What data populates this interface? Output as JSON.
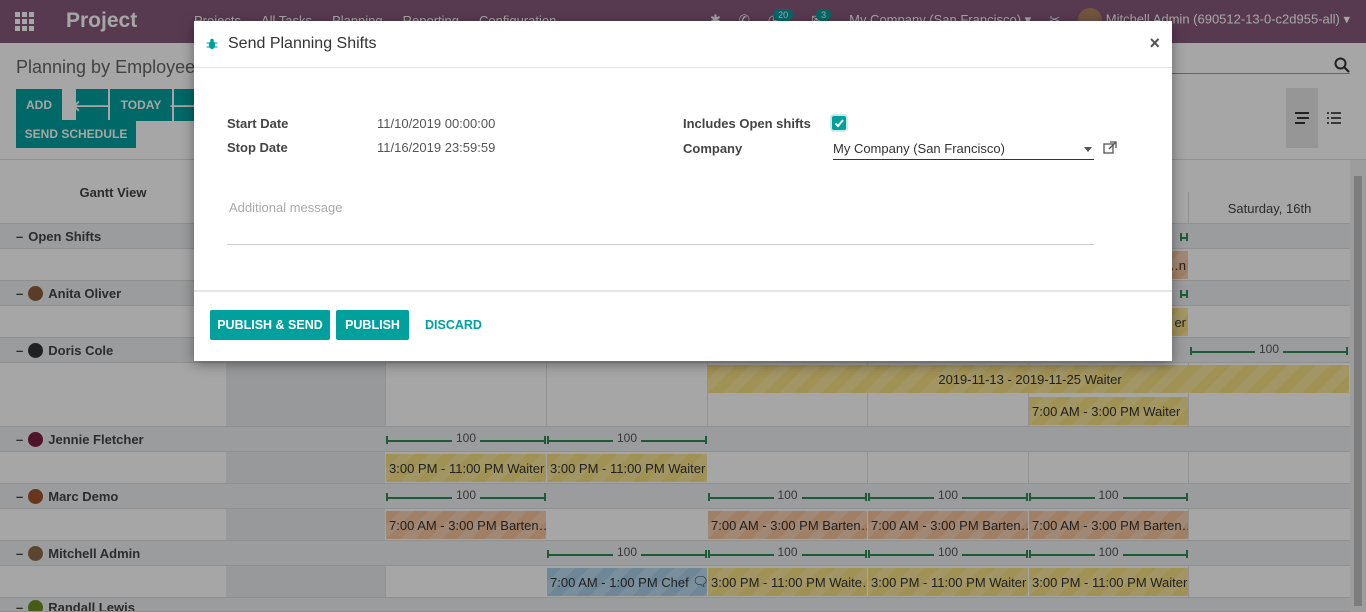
{
  "navbar": {
    "brand": "Project",
    "menu": [
      "Projects",
      "All Tasks",
      "Planning",
      "Reporting",
      "Configuration"
    ],
    "activity_count": "20",
    "messages_count": "3",
    "company": "My Company (San Francisco)",
    "user": "Mitchell Admin (690512-13-0-c2d955-all)",
    "colors": {
      "primary": "#875a7b",
      "accent": "#00a09d"
    }
  },
  "control": {
    "breadcrumb": "Planning by Employee",
    "add": "ADD",
    "today": "TODAY",
    "send_schedule": "SEND SCHEDULE",
    "icons": [
      "arrow-left-icon",
      "arrow-right-icon",
      "search-icon",
      "gantt-view-icon",
      "list-view-icon"
    ]
  },
  "gantt": {
    "title": "Gantt View",
    "last_day": "Saturday, 16th",
    "rows": [
      {
        "name": "Open Shifts",
        "has_avatar": false
      },
      {
        "name": "Anita Oliver",
        "has_avatar": true
      },
      {
        "name": "Doris Cole",
        "has_avatar": true
      },
      {
        "name": "Jennie Fletcher",
        "has_avatar": true
      },
      {
        "name": "Marc Demo",
        "has_avatar": true
      },
      {
        "name": "Mitchell Admin",
        "has_avatar": true
      },
      {
        "name": "Randall Lewis",
        "has_avatar": true
      }
    ],
    "allocation_label": "100",
    "shifts": {
      "open_partial": "…n",
      "anita_partial": "er",
      "doris_long": "2019-11-13 - 2019-11-25 Waiter",
      "doris_waiter": "7:00 AM - 3:00 PM Waiter",
      "jennie_1": "3:00 PM - 11:00 PM Waiter",
      "jennie_2": "3:00 PM - 11:00 PM Waiter",
      "marc_1": "7:00 AM - 3:00 PM Barten…",
      "marc_2": "7:00 AM - 3:00 PM Barten…",
      "marc_3": "7:00 AM - 3:00 PM Barten…",
      "marc_4": "7:00 AM - 3:00 PM Barten…",
      "mitchell_1": "7:00 AM - 1:00 PM Chef",
      "mitchell_2": "3:00 PM - 11:00 PM Waite…",
      "mitchell_3": "3:00 PM - 11:00 PM Waiter",
      "mitchell_4": "3:00 PM - 11:00 PM Waiter"
    }
  },
  "dialog": {
    "title": "Send Planning Shifts",
    "start_label": "Start Date",
    "start_value": "11/10/2019 00:00:00",
    "stop_label": "Stop Date",
    "stop_value": "11/16/2019 23:59:59",
    "open_shifts_label": "Includes Open shifts",
    "open_shifts_checked": true,
    "company_label": "Company",
    "company_value": "My Company (San Francisco)",
    "message_placeholder": "Additional message",
    "publish_send": "PUBLISH & SEND",
    "publish": "PUBLISH",
    "discard": "DISCARD"
  }
}
